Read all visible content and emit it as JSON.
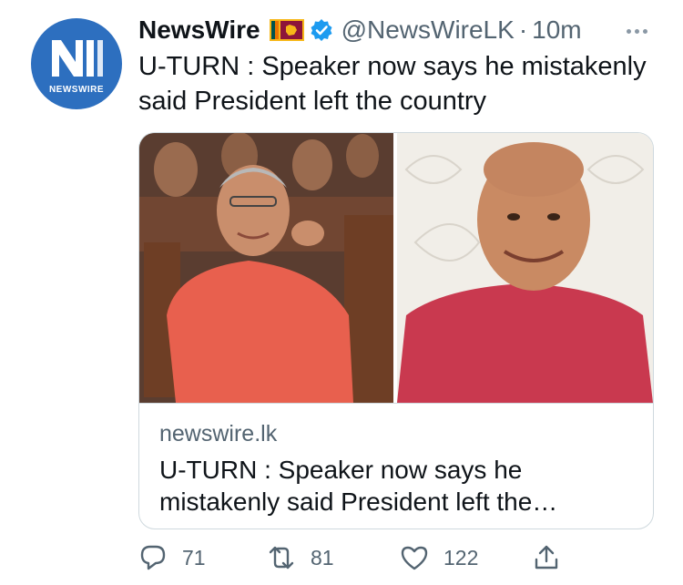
{
  "author": {
    "display_name": "NewsWire",
    "handle": "@NewsWireLK",
    "separator": "·",
    "time": "10m",
    "avatar_label": "NEWSWIRE",
    "verified_color": "#1d9bf0",
    "flag": "sri-lanka-flag",
    "avatar_color": "#2d6fbf"
  },
  "tweet": {
    "text": "U-TURN : Speaker now says he mistakenly said President left the country"
  },
  "card": {
    "domain": "newswire.lk",
    "title": "U-TURN : Speaker now says he mistakenly said President left the…"
  },
  "actions": {
    "reply_count": "71",
    "retweet_count": "81",
    "like_count": "122"
  },
  "icons": {
    "reply": "reply-icon",
    "retweet": "retweet-icon",
    "like": "heart-icon",
    "share": "share-icon",
    "more": "more-icon"
  },
  "colors": {
    "text_primary": "#0f1419",
    "text_secondary": "#536471",
    "border": "#cfd9de"
  }
}
